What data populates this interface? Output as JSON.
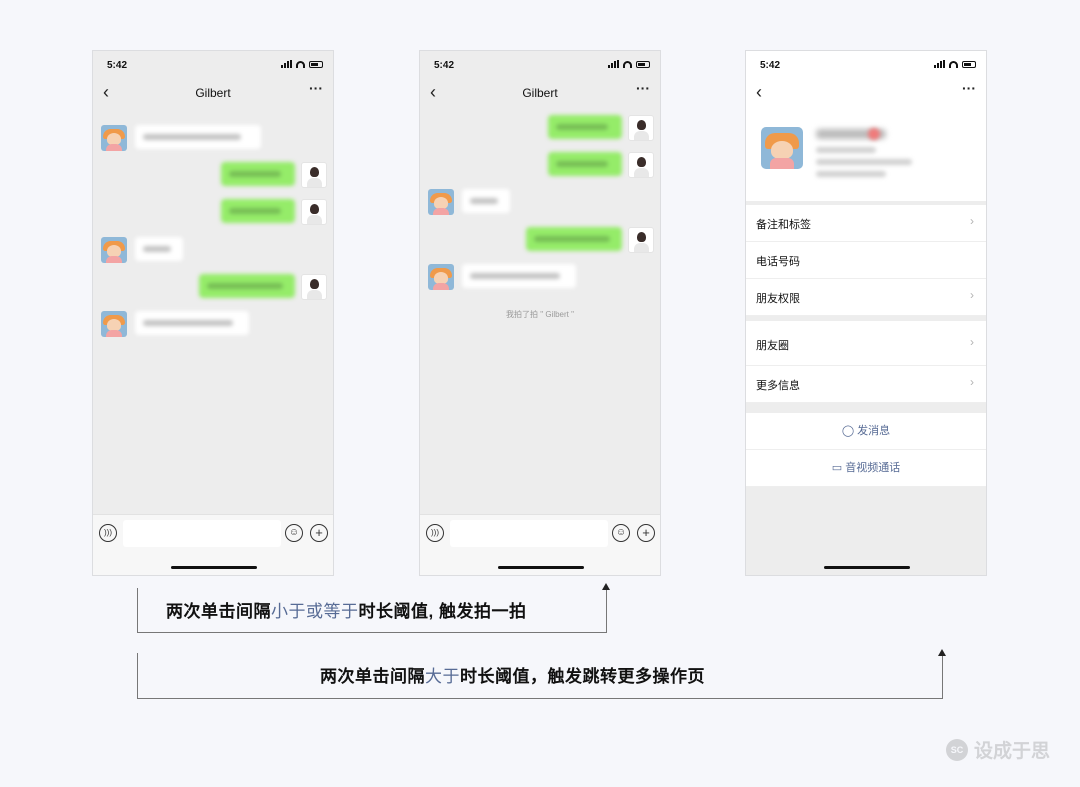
{
  "phones": {
    "status_time": "5:42",
    "chat_title": "Gilbert",
    "pat_note": "我拍了拍 \" Gilbert \"",
    "profile": {
      "rows_group1": [
        {
          "label": "备注和标签",
          "chevron": true
        },
        {
          "label": "电话号码",
          "chevron": false
        },
        {
          "label": "朋友权限",
          "chevron": true
        }
      ],
      "rows_group2": [
        {
          "label": "朋友圈",
          "chevron": true
        },
        {
          "label": "更多信息",
          "chevron": true
        }
      ],
      "actions": [
        {
          "label": "发消息",
          "icon": "chat-bubble-icon"
        },
        {
          "label": "音视频通话",
          "icon": "video-call-icon"
        }
      ]
    }
  },
  "captions": {
    "line1": {
      "pre": "两次单击间隔",
      "highlight": "小于或等于",
      "post": "时长阈值, 触发拍一拍"
    },
    "line2": {
      "pre": "两次单击间隔",
      "highlight": "大于",
      "post": "时长阈值，触发跳转更多操作页"
    }
  },
  "brand": {
    "logo_text": "设成于思"
  },
  "colors": {
    "accent": "#576b95",
    "bubble_out": "#95ec69",
    "bubble_in": "#ffffff",
    "background": "#f6f7fb"
  }
}
